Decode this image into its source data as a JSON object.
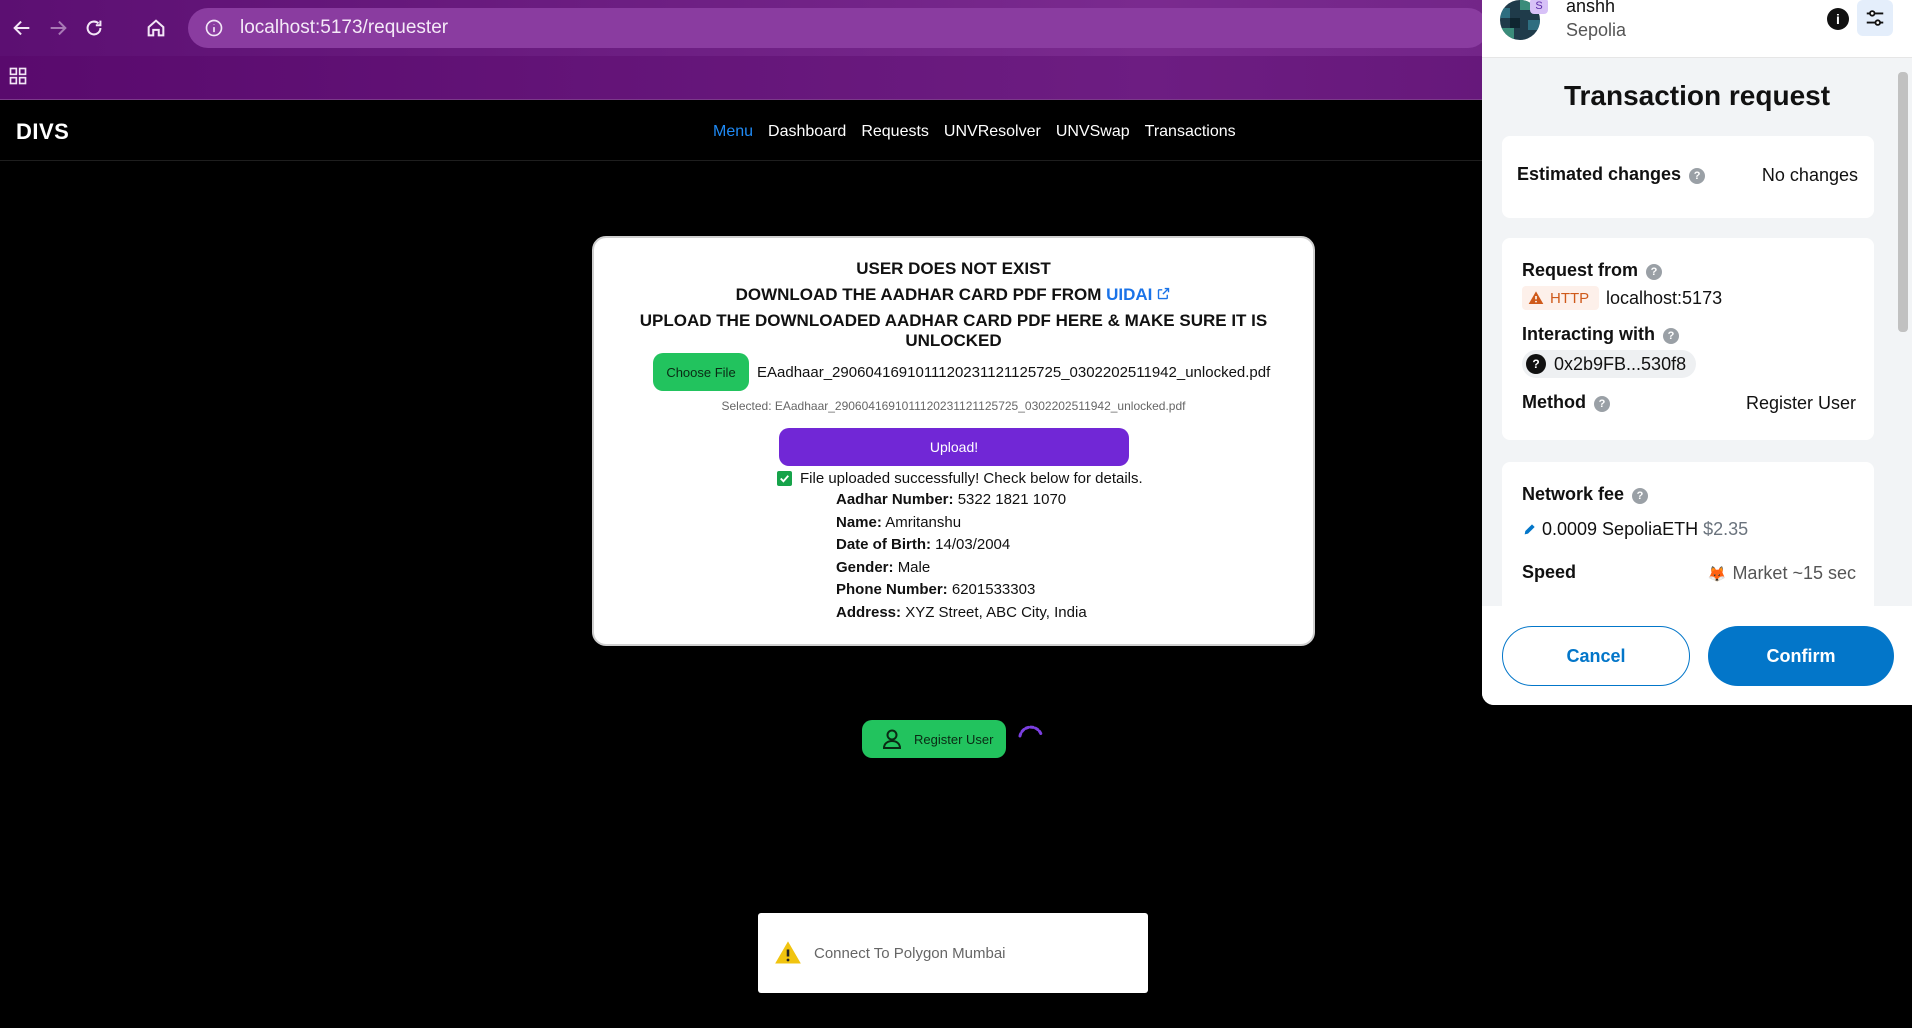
{
  "browser": {
    "url": "localhost:5173/requester"
  },
  "app": {
    "brand": "DIVS",
    "nav": [
      "Menu",
      "Dashboard",
      "Requests",
      "UNVResolver",
      "UNVSwap",
      "Transactions"
    ],
    "active_nav": "Menu"
  },
  "upload_card": {
    "line1": "USER DOES NOT EXIST",
    "line2_prefix": "DOWNLOAD THE AADHAR CARD PDF FROM",
    "line2_link": "UIDAI",
    "line3": "UPLOAD THE DOWNLOADED AADHAR CARD PDF HERE & MAKE SURE IT IS UNLOCKED",
    "choose_label": "Choose File",
    "file_name": "EAadhaar_2906041691011120231121125725_0302202511942_unlocked.pdf",
    "selected_note": "Selected: EAadhaar_2906041691011120231121125725_0302202511942_unlocked.pdf",
    "upload_label": "Upload!",
    "success_text": "File uploaded successfully! Check below for details.",
    "details": [
      {
        "label": "Aadhar Number:",
        "value": "5322 1821 1070"
      },
      {
        "label": "Name:",
        "value": "Amritanshu"
      },
      {
        "label": "Date of Birth:",
        "value": "14/03/2004"
      },
      {
        "label": "Gender:",
        "value": "Male"
      },
      {
        "label": "Phone Number:",
        "value": "6201533303"
      },
      {
        "label": "Address:",
        "value": "XYZ Street, ABC City, India"
      }
    ]
  },
  "register_button": {
    "label": "Register User"
  },
  "toast": {
    "text": "Connect To Polygon Mumbai"
  },
  "metamask": {
    "account_name": "anshh",
    "account_badge": "S",
    "network": "Sepolia",
    "title": "Transaction request",
    "estimated_changes_label": "Estimated changes",
    "estimated_changes_value": "No changes",
    "request_from_label": "Request from",
    "protocol": "HTTP",
    "origin": "localhost:5173",
    "interacting_with_label": "Interacting with",
    "contract_address": "0x2b9FB...530f8",
    "method_label": "Method",
    "method_value": "Register User",
    "network_fee_label": "Network fee",
    "fee_amount": "0.0009 SepoliaETH",
    "fee_fiat": "$2.35",
    "speed_label": "Speed",
    "speed_value": "Market ~15 sec",
    "cancel_label": "Cancel",
    "confirm_label": "Confirm"
  },
  "colors": {
    "chrome": "#6d1d82",
    "nav_active": "#1f8af5",
    "green_button": "#22c35e",
    "upload_button": "#7127d6",
    "metamask_blue": "#0376c9"
  }
}
